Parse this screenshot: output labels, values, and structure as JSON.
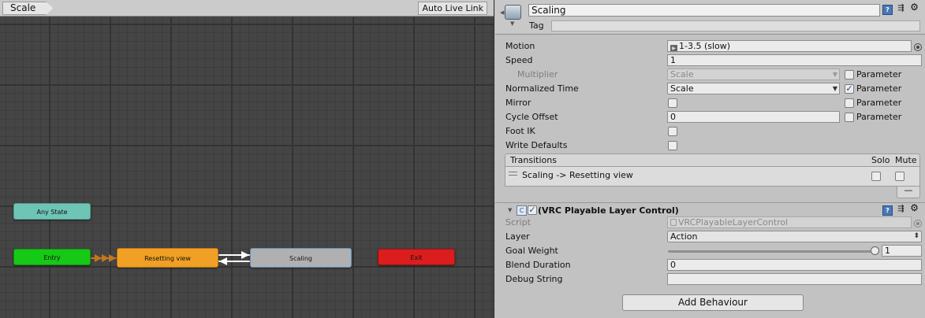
{
  "graph": {
    "breadcrumb": "Scale",
    "auto_live_link": "Auto Live Link",
    "states": {
      "any": "Any State",
      "entry": "Entry",
      "resetting": "Resetting view",
      "scaling": "Scaling",
      "exit": "Exit"
    },
    "colors": {
      "any": "#6fc5b5",
      "entry": "#16c916",
      "default_state": "#f0a024",
      "selected": "#b0b0b0",
      "exit": "#db1d1d"
    }
  },
  "inspector": {
    "state_name": "Scaling",
    "tag_label": "Tag",
    "tag_value": "",
    "header_icons": [
      "help-book-icon",
      "preset-icon",
      "gear-icon"
    ],
    "fields": {
      "motion": {
        "label": "Motion",
        "value": "1-3.5 (slow)"
      },
      "speed": {
        "label": "Speed",
        "value": "1"
      },
      "multiplier": {
        "label": "Multiplier",
        "value": "Scale",
        "param_label": "Parameter",
        "param_checked": false
      },
      "normalized_time": {
        "label": "Normalized Time",
        "value": "Scale",
        "param_label": "Parameter",
        "param_checked": true
      },
      "mirror": {
        "label": "Mirror",
        "checked": false,
        "param_label": "Parameter",
        "param_checked": false
      },
      "cycle_offset": {
        "label": "Cycle Offset",
        "value": "0",
        "param_label": "Parameter",
        "param_checked": false
      },
      "foot_ik": {
        "label": "Foot IK",
        "checked": false
      },
      "write_defaults": {
        "label": "Write Defaults",
        "checked": false
      }
    },
    "transitions": {
      "title": "Transitions",
      "solo_label": "Solo",
      "mute_label": "Mute",
      "items": [
        {
          "label": "Scaling -> Resetting view",
          "solo": false,
          "mute": false
        }
      ],
      "remove_label": "—"
    },
    "behaviour": {
      "title": "(VRC Playable Layer Control)",
      "enabled": true,
      "script": {
        "label": "Script",
        "value": "VRCPlayableLayerControl"
      },
      "layer": {
        "label": "Layer",
        "value": "Action"
      },
      "goal_weight": {
        "label": "Goal Weight",
        "value": "1",
        "level": 1.0
      },
      "blend_duration": {
        "label": "Blend Duration",
        "value": "0"
      },
      "debug_string": {
        "label": "Debug String",
        "value": ""
      }
    },
    "add_behaviour": "Add Behaviour"
  }
}
